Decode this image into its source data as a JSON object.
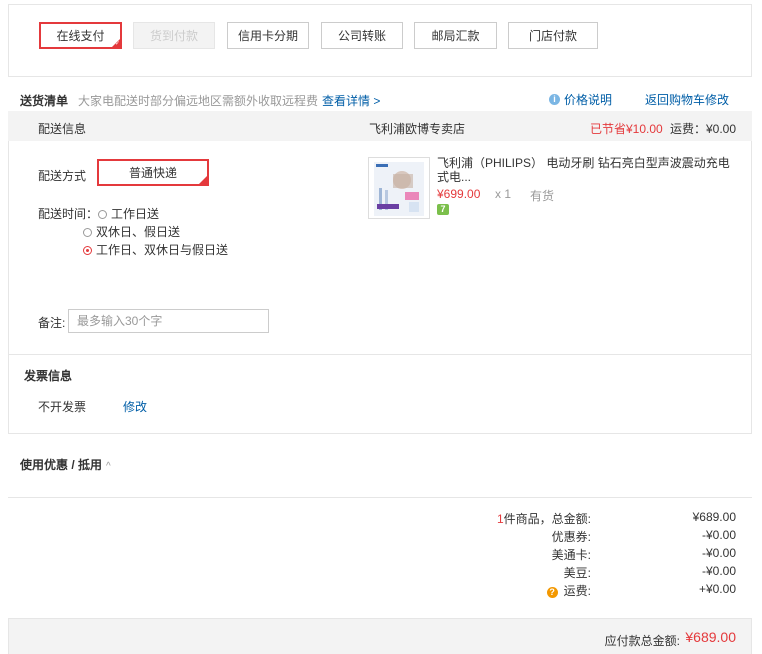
{
  "payment": {
    "methods": [
      {
        "label": "在线支付",
        "state": "selected"
      },
      {
        "label": "货到付款",
        "state": "disabled"
      },
      {
        "label": "信用卡分期",
        "state": "normal"
      },
      {
        "label": "公司转账",
        "state": "normal"
      },
      {
        "label": "邮局汇款",
        "state": "normal"
      },
      {
        "label": "门店付款",
        "state": "normal"
      }
    ]
  },
  "delivery_list": {
    "title": "送货清单",
    "note": "大家电配送时部分偏远地区需额外收取远程费",
    "detail_link": "查看详情 >",
    "price_info": "价格说明",
    "back_to_cart": "返回购物车修改"
  },
  "shipping": {
    "info_label": "配送信息",
    "store_name": "飞利浦欧博专卖店",
    "savings": "已节省¥10.00",
    "freight": "运费：¥0.00",
    "method_label": "配送方式",
    "method_value": "普通快递",
    "time_label": "配送时间：",
    "time_options": [
      "工作日送",
      "双休日、假日送",
      "工作日、双休日与假日送"
    ],
    "remark_label": "备注:",
    "remark_placeholder": "最多输入30个字"
  },
  "product": {
    "name": "飞利浦（PHILIPS） 电动牙刷 钻石亮白型声波震动充电式电...",
    "price": "¥699.00",
    "qty": "x 1",
    "stock": "有货",
    "badge": "7"
  },
  "invoice": {
    "title": "发票信息",
    "value": "不开发票",
    "edit": "修改"
  },
  "coupon": {
    "title": "使用优惠 / 抵用",
    "chevron": "^"
  },
  "summary": {
    "count": "1",
    "count_suffix": "件商品，总金额:",
    "total_goods": "¥689.00",
    "coupon_label": "优惠券:",
    "coupon_val": "-¥0.00",
    "card_label": "美通卡:",
    "card_val": "-¥0.00",
    "bean_label": "美豆:",
    "bean_val": "-¥0.00",
    "freight_label": "运费:",
    "freight_val": "+¥0.00",
    "payable_label": "应付款总金额:",
    "payable_val": "¥689.00"
  },
  "colors": {
    "accent": "#e4393c",
    "link": "#005ea7"
  }
}
